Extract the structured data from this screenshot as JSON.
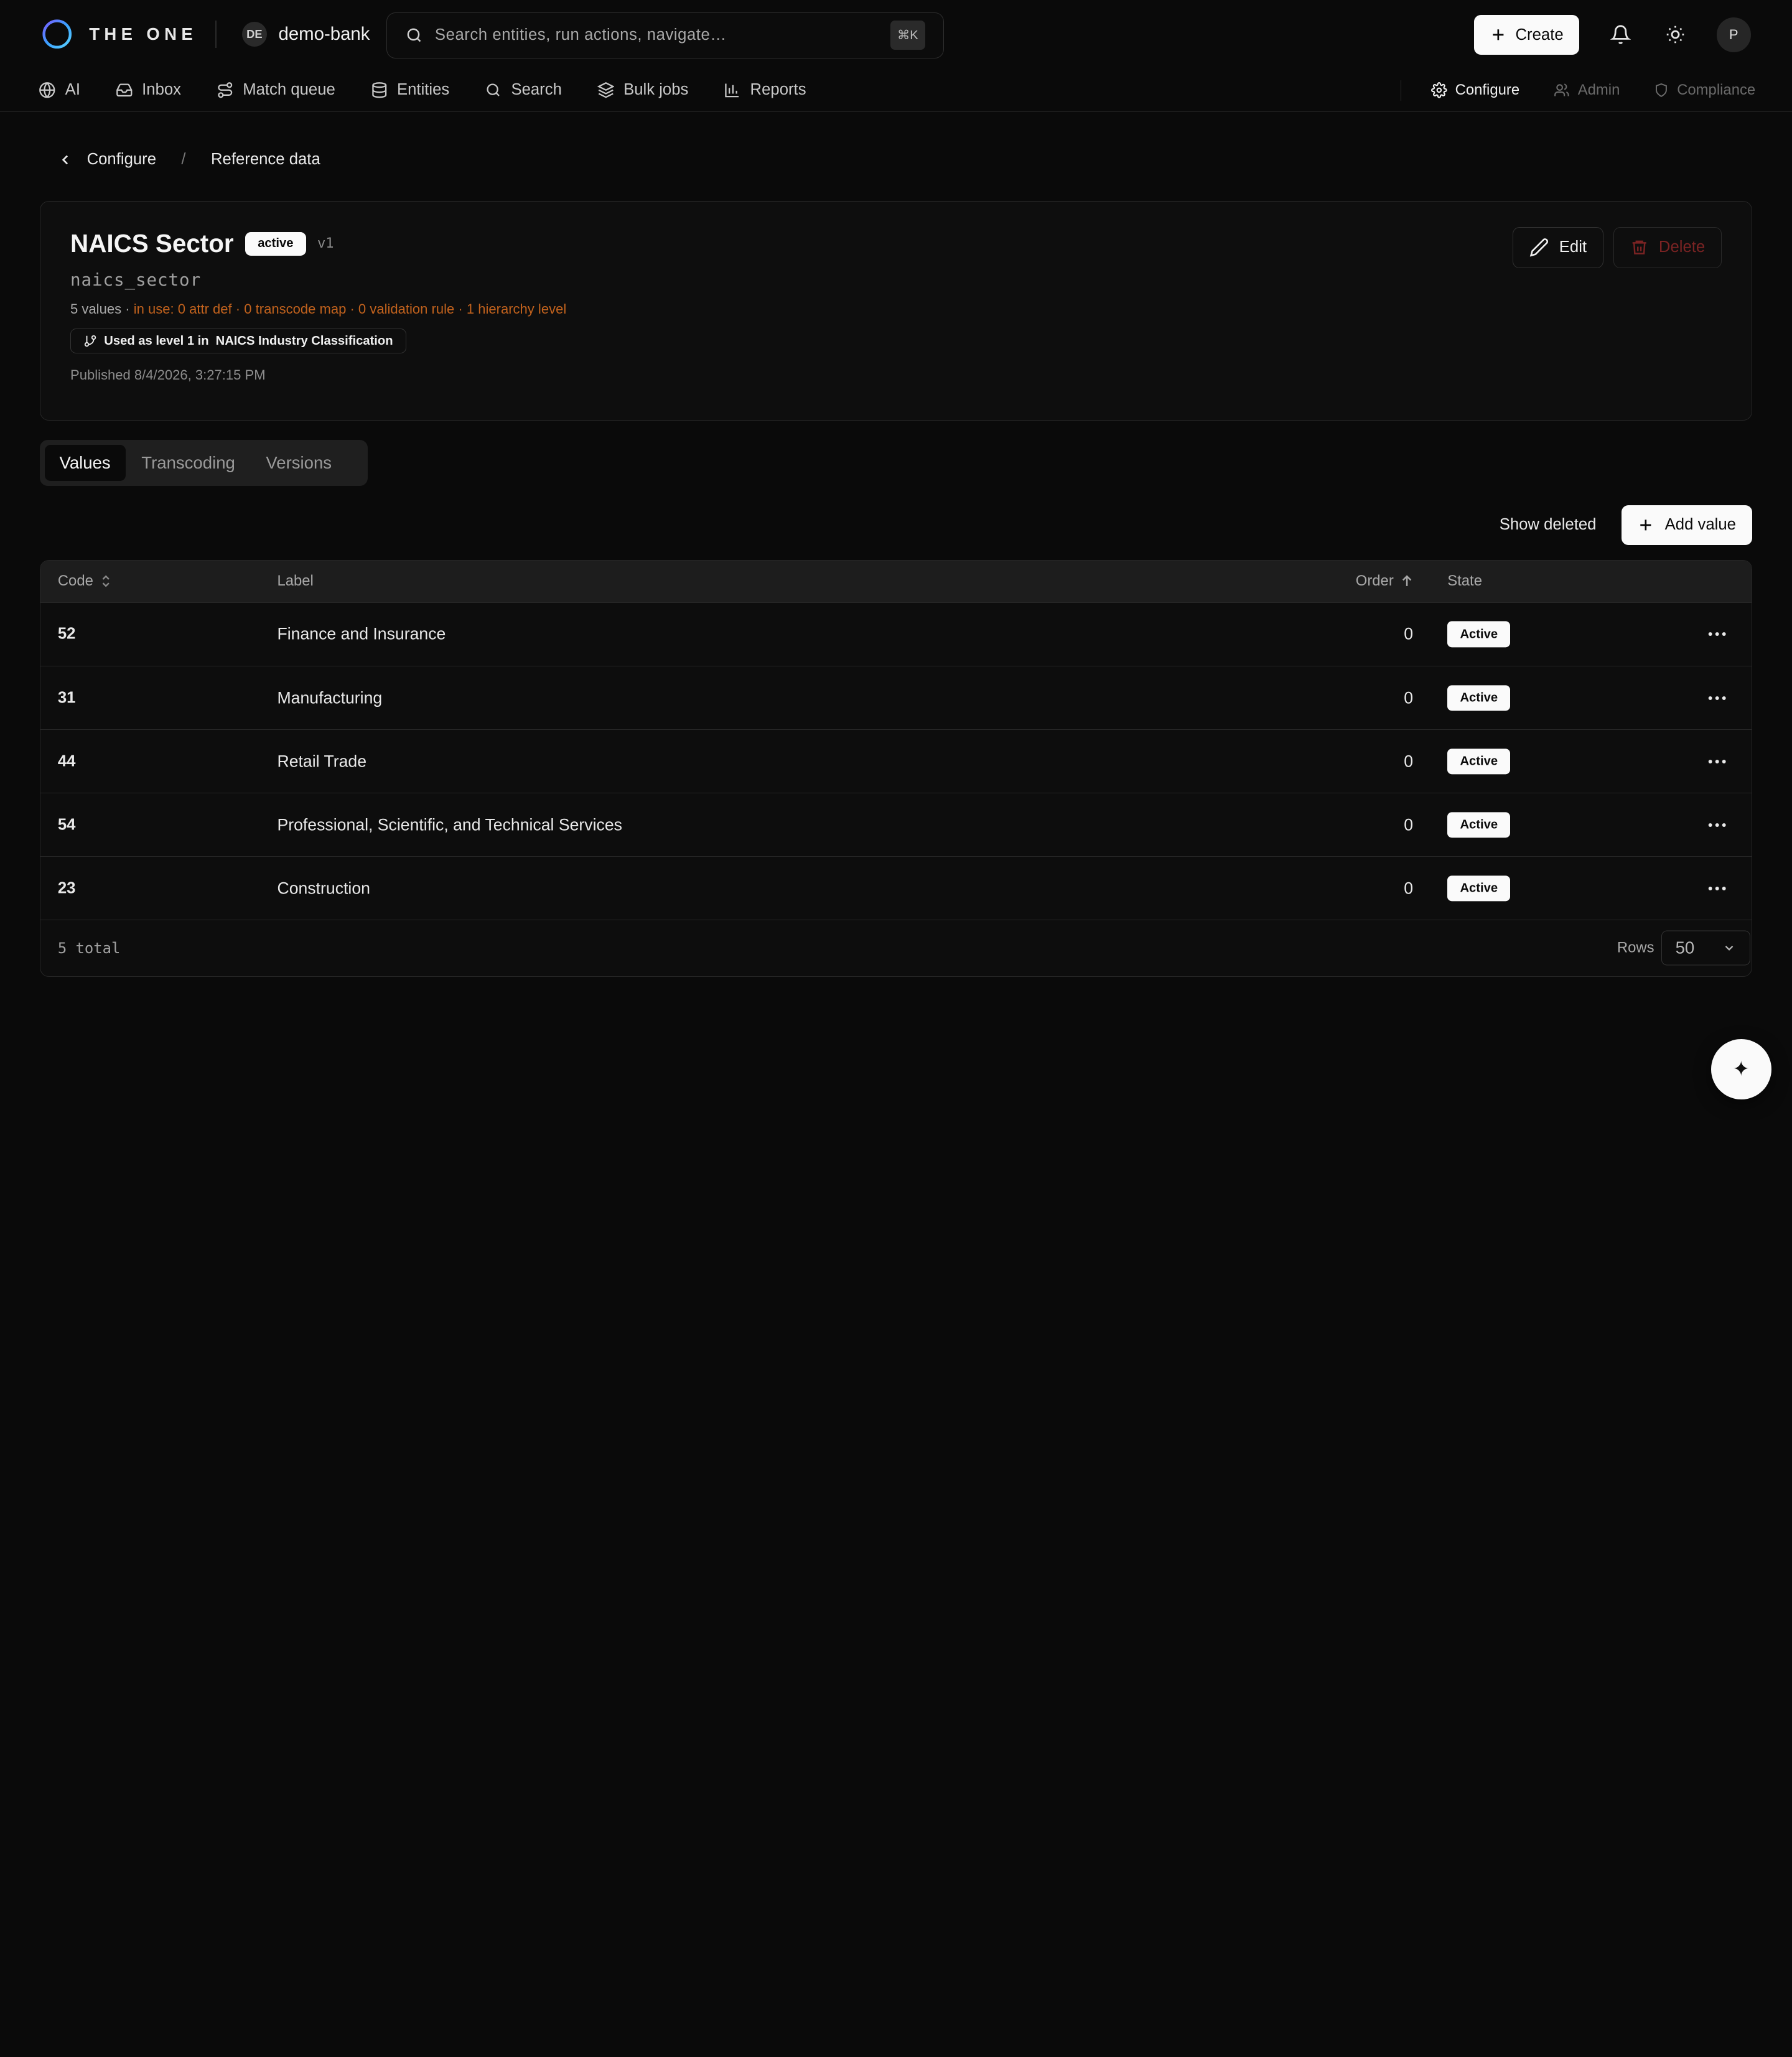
{
  "header": {
    "brand": "THE ONE",
    "workspace_badge": "DE",
    "workspace_name": "demo-bank",
    "search_placeholder": "Search entities, run actions, navigate…",
    "search_shortcut": "⌘K",
    "create_label": "Create",
    "avatar_initial": "P"
  },
  "nav": {
    "items": [
      {
        "label": "AI",
        "icon": "globe-icon"
      },
      {
        "label": "Inbox",
        "icon": "inbox-icon"
      },
      {
        "label": "Match queue",
        "icon": "route-icon"
      },
      {
        "label": "Entities",
        "icon": "database-icon"
      },
      {
        "label": "Search",
        "icon": "search-icon"
      },
      {
        "label": "Bulk jobs",
        "icon": "layers-icon"
      },
      {
        "label": "Reports",
        "icon": "bar-chart-icon"
      }
    ],
    "right": [
      {
        "label": "Configure",
        "icon": "gear-icon"
      },
      {
        "label": "Admin",
        "icon": "users-icon"
      },
      {
        "label": "Compliance",
        "icon": "shield-icon"
      }
    ]
  },
  "breadcrumb": {
    "back": "Configure",
    "separator": "/",
    "current": "Reference data"
  },
  "card": {
    "title": "NAICS Sector",
    "status": "active",
    "version": "v1",
    "key": "naics_sector",
    "values_count": "5 values",
    "usage_sep": " · ",
    "usage": "in use: 0 attr def · 0 transcode map · 0 validation rule · 1 hierarchy level",
    "chip_prefix": "Used as level 1 in",
    "chip_target": "NAICS Industry Classification",
    "published": "Published 8/4/2026, 3:27:15 PM",
    "edit_label": "Edit",
    "delete_label": "Delete"
  },
  "tabs": [
    {
      "label": "Values"
    },
    {
      "label": "Transcoding"
    },
    {
      "label": "Versions"
    }
  ],
  "toolbar": {
    "show_deleted": "Show deleted",
    "add_value": "Add value"
  },
  "table": {
    "columns": {
      "code": "Code",
      "label": "Label",
      "order": "Order",
      "state": "State"
    },
    "rows": [
      {
        "code": "52",
        "label": "Finance and Insurance",
        "order": "0",
        "state": "Active"
      },
      {
        "code": "31",
        "label": "Manufacturing",
        "order": "0",
        "state": "Active"
      },
      {
        "code": "44",
        "label": "Retail Trade",
        "order": "0",
        "state": "Active"
      },
      {
        "code": "54",
        "label": "Professional, Scientific, and Technical Services",
        "order": "0",
        "state": "Active"
      },
      {
        "code": "23",
        "label": "Construction",
        "order": "0",
        "state": "Active"
      }
    ],
    "total": "5 total",
    "rows_label": "Rows",
    "rows_value": "50"
  },
  "colors": {
    "background": "#0a0a0a",
    "warning": "#c2621d",
    "danger": "#7a2323"
  }
}
